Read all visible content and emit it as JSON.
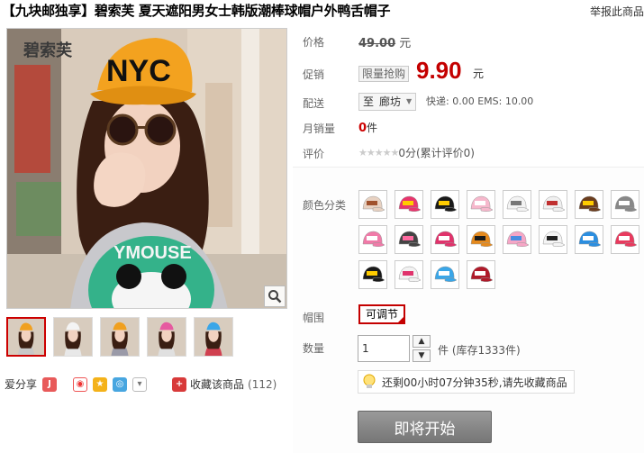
{
  "header": {
    "title": "【九块邮独享】碧索芙 夏天遮阳男女士韩版潮棒球帽户外鸭舌帽子",
    "report_link": "举报此商品"
  },
  "main_image": {
    "watermark_brand": "碧索芙",
    "cap_text": "NYC",
    "shirt_text": "YMOUSE"
  },
  "price": {
    "label": "价格",
    "value": "49.00",
    "unit": "元"
  },
  "promo": {
    "label": "促销",
    "tag": "限量抢购",
    "value": "9.90",
    "unit": "元"
  },
  "shipping": {
    "label": "配送",
    "to_prefix": "至",
    "location": "廊坊",
    "info": "快递: 0.00 EMS: 10.00"
  },
  "monthly_sales": {
    "label": "月销量",
    "count": "0",
    "unit": "件"
  },
  "rating": {
    "label": "评价",
    "stars": "★★★★★",
    "text": "0分(累计评价0)"
  },
  "color_option": {
    "label": "颜色分类",
    "swatches": [
      {
        "cap": "#e8d2c2",
        "text": "#a0522d"
      },
      {
        "cap": "#e8356d",
        "text": "#ffcc00"
      },
      {
        "cap": "#1a1a1a",
        "text": "#ffcc00"
      },
      {
        "cap": "#f6b8cc",
        "text": "#ffffff"
      },
      {
        "cap": "#f3f3f3",
        "text": "#777777"
      },
      {
        "cap": "#f0f0f0",
        "text": "#c03030"
      },
      {
        "cap": "#6b3d1e",
        "text": "#ffcc00"
      },
      {
        "cap": "#888888",
        "text": "#ffffff"
      },
      {
        "cap": "#f07aa8",
        "text": "#ffffff"
      },
      {
        "cap": "#444444",
        "text": "#ff6aa0"
      },
      {
        "cap": "#e0336c",
        "text": "#ffffff"
      },
      {
        "cap": "#e58a1e",
        "text": "#1a1a1a"
      },
      {
        "cap": "#f6a6c6",
        "text": "#4a8de0"
      },
      {
        "cap": "#f4f4f4",
        "text": "#222222"
      },
      {
        "cap": "#2b8ee0",
        "text": "#ffffff"
      },
      {
        "cap": "#e83a5e",
        "text": "#ffffff"
      },
      {
        "cap": "#1a1a1a",
        "text": "#ffcc00"
      },
      {
        "cap": "#f2f2f2",
        "text": "#e0336c"
      },
      {
        "cap": "#3aa6e8",
        "text": "#ffffff"
      },
      {
        "cap": "#b01a2a",
        "text": "#ffffff"
      }
    ]
  },
  "size_option": {
    "label": "帽围",
    "value": "可调节"
  },
  "quantity": {
    "label": "数量",
    "value": "1",
    "unit_stock": "件 (库存1333件)"
  },
  "countdown": {
    "text": "还剩00小时07分钟35秒,请先收藏商品"
  },
  "buy_button": {
    "label": "即将开始"
  },
  "share": {
    "label": "爱分享",
    "favorite_label": "收藏该商品",
    "favorite_count": "(112)"
  },
  "thumbnails": [
    {
      "cap": "#f0a020",
      "shirt": "#c8c8c8"
    },
    {
      "cap": "#f4f4f4",
      "shirt": "#e8e8e8"
    },
    {
      "cap": "#f0a020",
      "shirt": "#9a9aa8"
    },
    {
      "cap": "#e65aa0",
      "shirt": "#e0e0e0"
    },
    {
      "cap": "#3aa6e8",
      "shirt": "#d04050"
    }
  ],
  "colors": {
    "promo_red": "#c40000",
    "selected_border": "#c40000",
    "buy_button_gray": "#878787"
  }
}
